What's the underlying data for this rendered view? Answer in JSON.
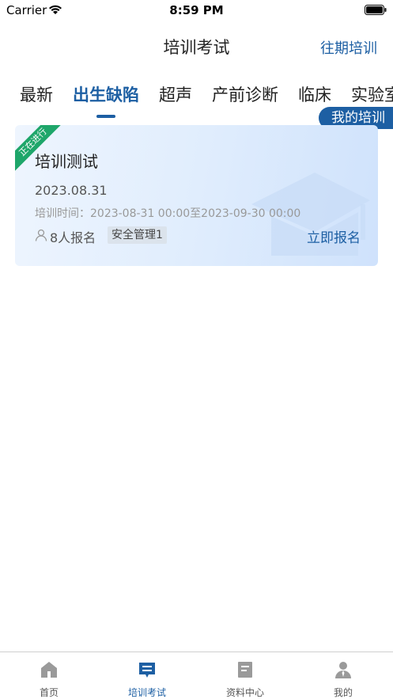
{
  "status_bar": {
    "carrier": "Carrier",
    "time": "8:59 PM"
  },
  "nav": {
    "title": "培训考试",
    "right_action": "往期培训"
  },
  "tabs": [
    {
      "label": "最新",
      "active": false
    },
    {
      "label": "出生缺陷",
      "active": true
    },
    {
      "label": "超声",
      "active": false
    },
    {
      "label": "产前诊断",
      "active": false
    },
    {
      "label": "临床",
      "active": false
    },
    {
      "label": "实验室",
      "active": false
    }
  ],
  "my_training_button": "我的培训",
  "card": {
    "status_ribbon": "正在进行",
    "title": "培训测试",
    "date": "2023.08.31",
    "time_range": "培训时间：2023-08-31 00:00至2023-09-30 00:00",
    "enroll_count": "8人报名",
    "category": "安全管理1",
    "action": "立即报名"
  },
  "tabbar": [
    {
      "label": "首页",
      "icon": "home-icon",
      "active": false
    },
    {
      "label": "培训考试",
      "icon": "training-icon",
      "active": true
    },
    {
      "label": "资料中心",
      "icon": "document-icon",
      "active": false
    },
    {
      "label": "我的",
      "icon": "profile-icon",
      "active": false
    }
  ],
  "colors": {
    "accent": "#1d5fa3",
    "ribbon": "#1ea66a",
    "card_bg": "#e0edfd"
  }
}
